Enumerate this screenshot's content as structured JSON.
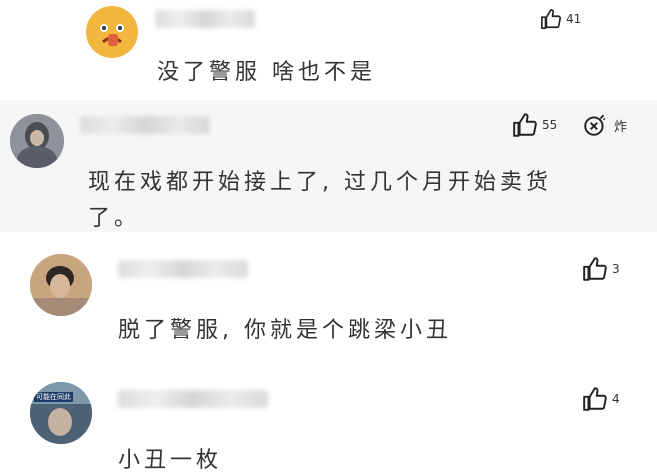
{
  "comments": [
    {
      "text": "没了警服 啥也不是",
      "likes": "41"
    },
    {
      "text_line1": "现在戏都开始接上了, 过几个月开始卖货",
      "text_line2": "了。",
      "likes": "55",
      "action_label": "炸"
    },
    {
      "text": "脱了警服, 你就是个跳梁小丑",
      "likes": "3"
    },
    {
      "text": "小丑一枚",
      "likes": "4",
      "avatar_caption": "可能在同此"
    }
  ],
  "colors": {
    "highlight_bg": "#f6f6f6",
    "text": "#333333",
    "icon": "#222222"
  }
}
